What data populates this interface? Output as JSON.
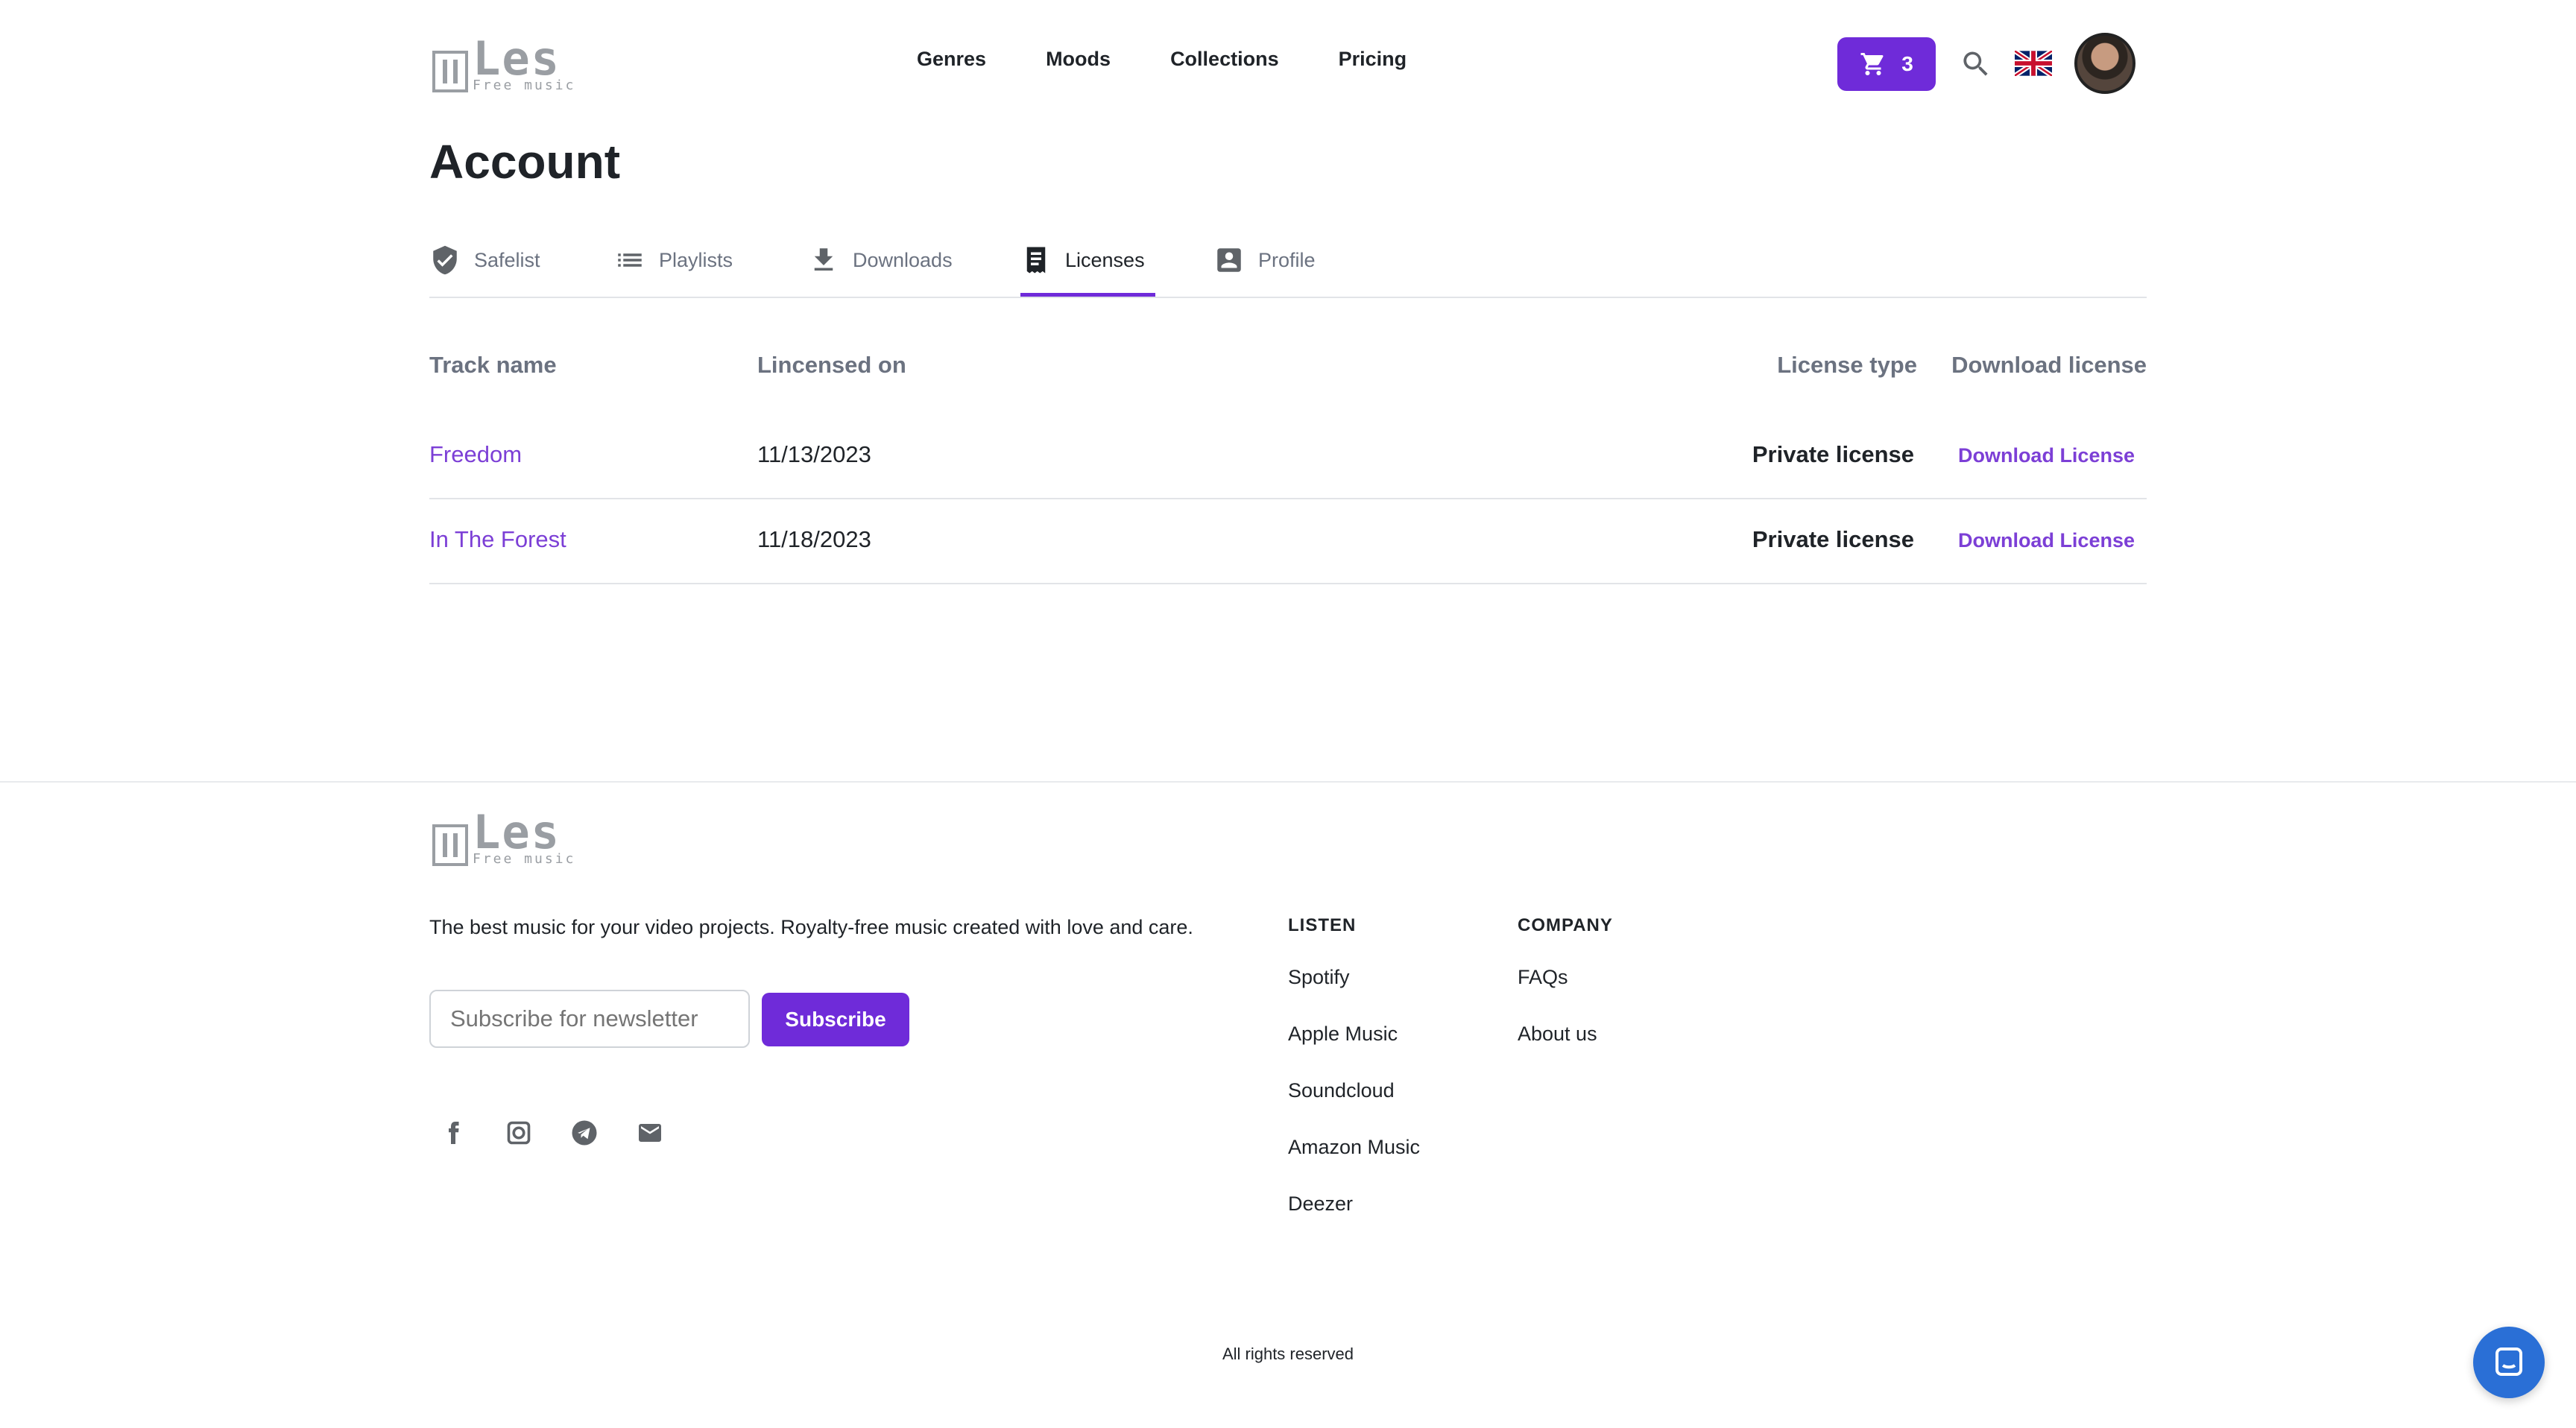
{
  "brand": {
    "logo_word": "Les",
    "logo_sub": "Free music"
  },
  "nav": {
    "items": [
      "Genres",
      "Moods",
      "Collections",
      "Pricing"
    ]
  },
  "header": {
    "cart_count": "3",
    "language": "en-GB flag"
  },
  "page": {
    "title": "Account"
  },
  "tabs": [
    {
      "label": "Safelist",
      "icon": "shield-check-icon",
      "active": false
    },
    {
      "label": "Playlists",
      "icon": "list-icon",
      "active": false
    },
    {
      "label": "Downloads",
      "icon": "download-icon",
      "active": false
    },
    {
      "label": "Licenses",
      "icon": "receipt-icon",
      "active": true
    },
    {
      "label": "Profile",
      "icon": "profile-icon",
      "active": false
    }
  ],
  "table": {
    "headers": {
      "track": "Track name",
      "licensed_on": "Lincensed on",
      "type": "License type",
      "download": "Download license"
    },
    "rows": [
      {
        "track": "Freedom",
        "date": "11/13/2023",
        "type": "Private license",
        "action": "Download License"
      },
      {
        "track": "In The Forest",
        "date": "11/18/2023",
        "type": "Private license",
        "action": "Download License"
      }
    ]
  },
  "footer": {
    "description": "The best music for your video projects. Royalty-free music created with love and care.",
    "newsletter_placeholder": "Subscribe for newsletter",
    "subscribe_label": "Subscribe",
    "listen": {
      "heading": "LISTEN",
      "items": [
        "Spotify",
        "Apple Music",
        "Soundcloud",
        "Amazon Music",
        "Deezer"
      ]
    },
    "company": {
      "heading": "COMPANY",
      "items": [
        "FAQs",
        "About us"
      ]
    },
    "copyright": "All rights reserved",
    "social": [
      "facebook-icon",
      "instagram-icon",
      "telegram-icon",
      "email-icon"
    ]
  },
  "colors": {
    "accent": "#6f2bd9",
    "link": "#7c3fd6",
    "chat": "#2a6fd6"
  }
}
